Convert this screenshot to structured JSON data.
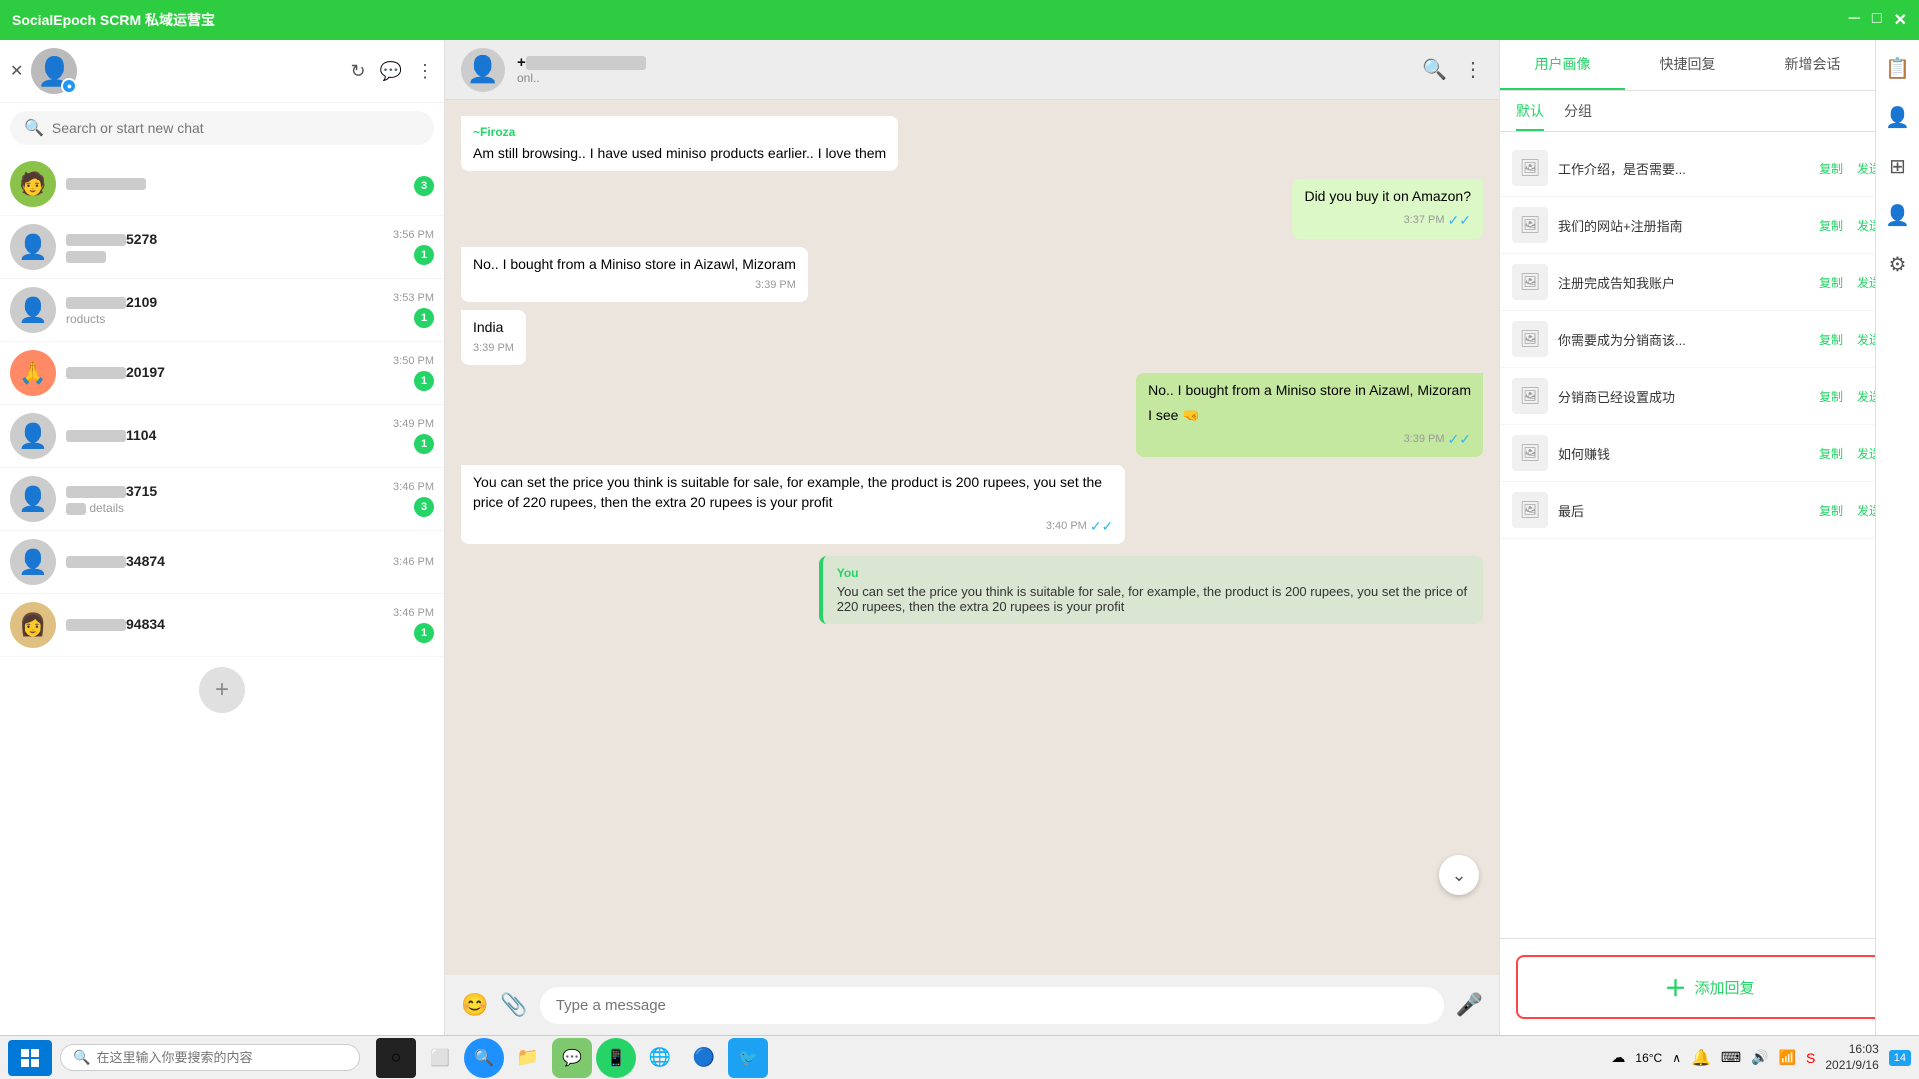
{
  "app": {
    "title": "SocialEpoch SCRM 私域运营宝",
    "controls": [
      "─",
      "□",
      "✕"
    ]
  },
  "sidebar": {
    "search_placeholder": "Search or start new chat",
    "chats": [
      {
        "id": 1,
        "name": "████████",
        "preview": "",
        "time": "",
        "badge": 0,
        "hasImage": true
      },
      {
        "id": 2,
        "name": "████████5278",
        "preview": "██",
        "time": "3:56 PM",
        "badge": 1,
        "hasImage": false
      },
      {
        "id": 3,
        "name": "████████2109",
        "preview": "roducts",
        "time": "3:53 PM",
        "badge": 1,
        "hasImage": false
      },
      {
        "id": 4,
        "name": "████████20197",
        "preview": "",
        "time": "3:50 PM",
        "badge": 1,
        "hasImage": true
      },
      {
        "id": 5,
        "name": "████████1104",
        "preview": "",
        "time": "3:49 PM",
        "badge": 1,
        "hasImage": false
      },
      {
        "id": 6,
        "name": "████████3715",
        "preview": "█ details",
        "time": "3:46 PM",
        "badge": 3,
        "hasImage": false
      },
      {
        "id": 7,
        "name": "████████34874",
        "preview": "",
        "time": "3:46 PM",
        "badge": 0,
        "hasImage": false
      },
      {
        "id": 8,
        "name": "████████94834",
        "preview": "",
        "time": "3:46 PM",
        "badge": 1,
        "hasImage": true
      }
    ]
  },
  "chat": {
    "contact_name": "+██████████",
    "status": "onl..",
    "messages": [
      {
        "id": 1,
        "type": "incoming",
        "sender": "~Firoza",
        "text": "Am still browsing.. I have used miniso products earlier.. I love them",
        "time": null
      },
      {
        "id": 2,
        "type": "outgoing",
        "sender": null,
        "text": "Did you buy it on Amazon?",
        "time": "3:37 PM",
        "ticks": "✓✓"
      },
      {
        "id": 3,
        "type": "incoming",
        "sender": null,
        "text": "No.. I bought from a Miniso store in Aizawl, Mizoram",
        "time": "3:39 PM"
      },
      {
        "id": 4,
        "type": "incoming",
        "sender": null,
        "text": "India",
        "time": "3:39 PM"
      },
      {
        "id": 5,
        "type": "outgoing_group",
        "sender": null,
        "lines": [
          "No.. I bought from a Miniso store in Aizawl, Mizoram",
          "I see 🤜"
        ],
        "time": "3:39 PM",
        "ticks": "✓✓"
      },
      {
        "id": 6,
        "type": "incoming",
        "sender": null,
        "text": "You can set the price you think is suitable for sale, for example, the product is 200 rupees, you set the price of 220 rupees, then the extra 20 rupees is your profit",
        "time": "3:40 PM",
        "ticks": "✓✓"
      },
      {
        "id": 7,
        "type": "preview",
        "sender": "You",
        "text": "You can set the price you think is suitable for sale, for example, the product is 200 rupees, you set the price of 220 rupees, then the extra 20 rupees is your profit"
      }
    ],
    "type_placeholder": "Type a message"
  },
  "right_panel": {
    "tabs": [
      "用户画像",
      "快捷回复",
      "新增会话"
    ],
    "tag_tabs": [
      "默认",
      "分组"
    ],
    "quick_replies": [
      {
        "id": 1,
        "text": "工作介绍，是否需要..."
      },
      {
        "id": 2,
        "text": "我们的网站+注册指南"
      },
      {
        "id": 3,
        "text": "注册完成告知我账户"
      },
      {
        "id": 4,
        "text": "你需要成为分销商该..."
      },
      {
        "id": 5,
        "text": "分销商已经设置成功"
      },
      {
        "id": 6,
        "text": "如何赚钱"
      },
      {
        "id": 7,
        "text": "最后"
      }
    ],
    "btn_copy": "复制",
    "btn_send": "发送",
    "add_reply_label": "添加回复"
  },
  "taskbar": {
    "search_placeholder": "在这里输入你要搜索的内容",
    "time": "16:03",
    "date": "2021/9/16",
    "notification_count": "14",
    "temperature": "16°C"
  }
}
